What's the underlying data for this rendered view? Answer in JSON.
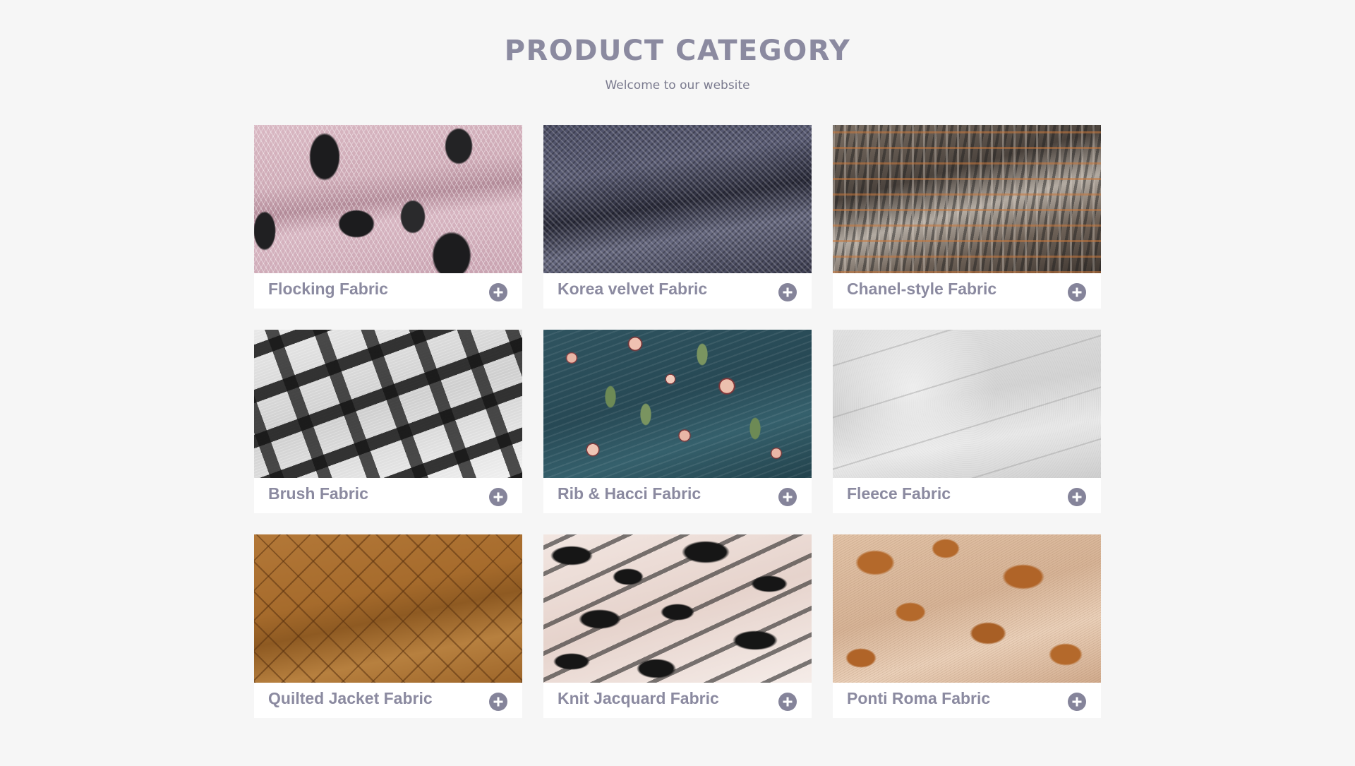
{
  "header": {
    "title": "PRODUCT CATEGORY",
    "subtitle": "Welcome to our website"
  },
  "categories": [
    {
      "label": "Flocking Fabric",
      "texture": "pink mesh with black flocked leaves"
    },
    {
      "label": "Korea velvet Fabric",
      "texture": "navy knit mesh"
    },
    {
      "label": "Chanel-style Fabric",
      "texture": "tweed plaid with copper threads"
    },
    {
      "label": "Brush Fabric",
      "texture": "black and white brushed plaid"
    },
    {
      "label": "Rib & Hacci Fabric",
      "texture": "teal rib with pink florals"
    },
    {
      "label": "Fleece Fabric",
      "texture": "light heather grey fleece"
    },
    {
      "label": "Quilted Jacket Fabric",
      "texture": "tan diamond quilted"
    },
    {
      "label": "Knit Jacquard Fabric",
      "texture": "black and blush animal print"
    },
    {
      "label": "Ponti Roma Fabric",
      "texture": "beige with brown cow spots"
    }
  ],
  "colors": {
    "background": "#f6f6f6",
    "card": "#ffffff",
    "text_accent": "#8b8aa0",
    "icon": "#85849a"
  },
  "icon": "plus-circle-icon"
}
